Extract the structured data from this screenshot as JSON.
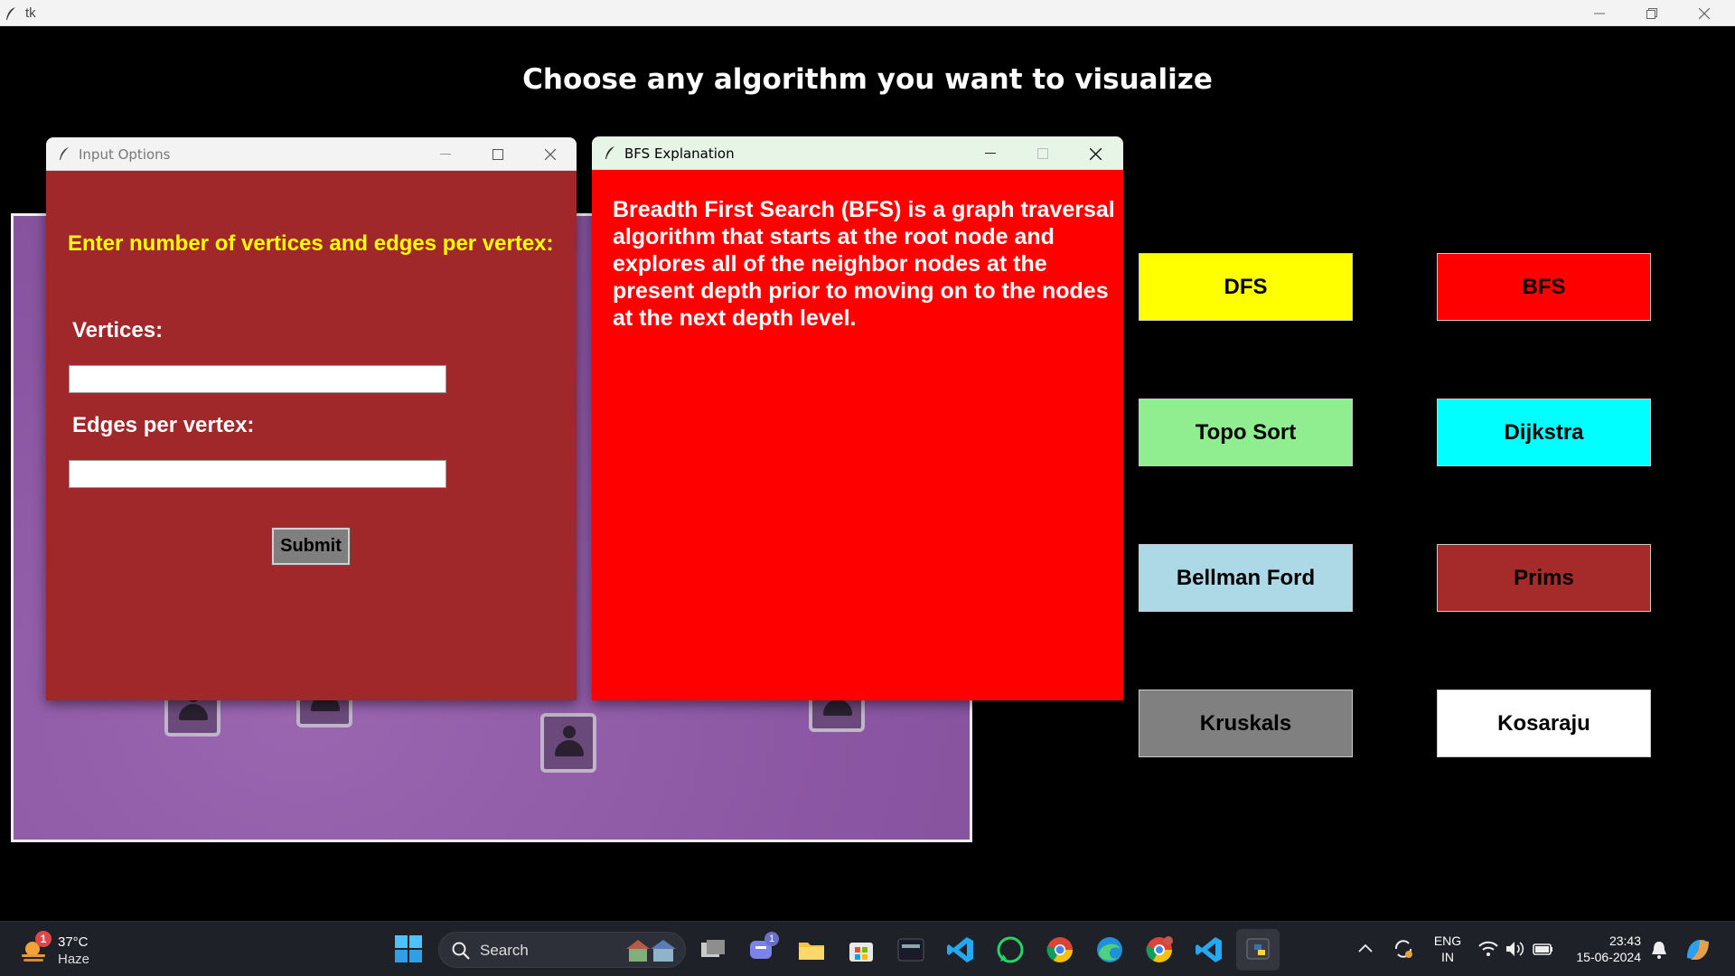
{
  "main_window": {
    "title": "tk"
  },
  "heading": "Choose any algorithm you want to visualize",
  "input_window": {
    "title": "Input Options",
    "prompt": "Enter number of vertices and edges per vertex:",
    "vertices_label": "Vertices:",
    "vertices_value": "",
    "edges_label": "Edges per vertex:",
    "edges_value": "",
    "submit_label": "Submit"
  },
  "bfs_window": {
    "title": "BFS Explanation",
    "text": "Breadth First Search (BFS) is a graph traversal algorithm that starts at the root node and explores all of the neighbor nodes at the present depth prior to moving on to the nodes at the next depth level."
  },
  "algorithms": [
    {
      "label": "DFS",
      "color": "#ffff00"
    },
    {
      "label": "BFS",
      "color": "#ff0000"
    },
    {
      "label": "Topo Sort",
      "color": "#90ee90"
    },
    {
      "label": "Dijkstra",
      "color": "#00ffff"
    },
    {
      "label": "Bellman Ford",
      "color": "#add8e6"
    },
    {
      "label": "Prims",
      "color": "#a52a2a"
    },
    {
      "label": "Kruskals",
      "color": "#808080"
    },
    {
      "label": "Kosaraju",
      "color": "#ffffff"
    }
  ],
  "taskbar": {
    "weather_temp": "37°C",
    "weather_desc": "Haze",
    "weather_badge": "1",
    "search_label": "Search",
    "teams_badge": "1",
    "language_line1": "ENG",
    "language_line2": "IN",
    "time": "23:43",
    "date": "15-06-2024"
  }
}
